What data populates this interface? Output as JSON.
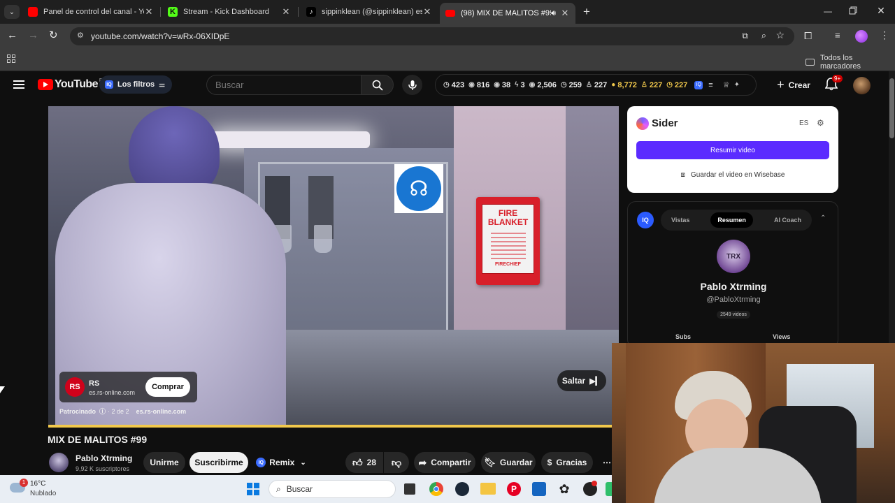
{
  "browser": {
    "tabs": [
      {
        "title": "Panel de control del canal - You",
        "active": false
      },
      {
        "title": "Stream - Kick Dashboard",
        "active": false
      },
      {
        "title": "sippinklean (@sippinklean) está",
        "active": false
      },
      {
        "title": "(98) MIX DE MALITOS #99",
        "active": true
      }
    ],
    "url": "youtube.com/watch?v=wRx-06XIDpE",
    "bookmarks_label": "Todos los marcadores"
  },
  "youtube": {
    "logo_text": "YouTube",
    "logo_region": "ES",
    "filters_label": "Los filtros",
    "search_placeholder": "Buscar",
    "stats": [
      "423",
      "816",
      "38",
      "3",
      "2,506",
      "259",
      "227",
      "8,772",
      "227",
      "227"
    ],
    "create_label": "Crear",
    "notif_badge": "9+",
    "colors": {
      "brand_red": "#ff0000",
      "accent_purple": "#5b2bff",
      "gold": "#f2c94c"
    }
  },
  "video": {
    "sign_text_1": "FIRE",
    "sign_text_2": "BLANKET",
    "sign_brand": "FIRECHIEF",
    "ad": {
      "logo": "RS",
      "name": "RS",
      "domain": "es.rs-online.com",
      "buy_label": "Comprar",
      "sponsored_label": "Patrocinado",
      "counter": "· 2 de 2",
      "footer_domain": "es.rs-online.com"
    },
    "skip_label": "Saltar",
    "progress": 0.99
  },
  "meta": {
    "title": "MIX DE MALITOS #99",
    "channel_name": "Pablo Xtrming",
    "subscribers": "9,92 K suscriptores",
    "join_label": "Unirme",
    "subscribe_label": "Suscribirme",
    "remix_label": "Remix",
    "likes": "28",
    "share_label": "Compartir",
    "save_label": "Guardar",
    "thanks_label": "Gracias"
  },
  "sider": {
    "title": "Sider",
    "lang": "ES",
    "summarize_label": "Resumir video",
    "wisebase_label": "Guardar el video en Wisebase"
  },
  "iq": {
    "badge": "IQ",
    "tabs": [
      "Vistas",
      "Resumen",
      "AI Coach"
    ],
    "active_tab": "Resumen",
    "avatar_text": "TRX",
    "channel_name": "Pablo Xtrming",
    "handle": "@PabloXtrming",
    "videos": "2549 videos",
    "col_subs": "Subs",
    "col_views": "Views"
  },
  "taskbar": {
    "temp": "16°C",
    "weather": "Nublado",
    "weather_badge": "1",
    "search_placeholder": "Buscar"
  }
}
